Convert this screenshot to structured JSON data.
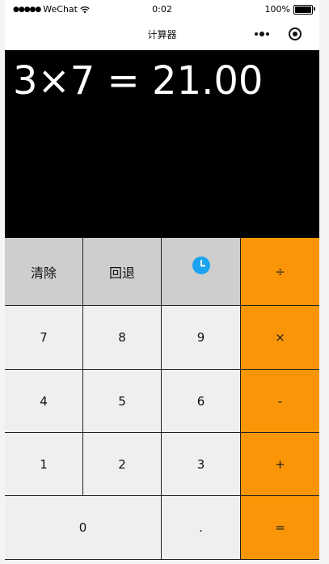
{
  "status_bar": {
    "signal": "●●●●●",
    "carrier": "WeChat",
    "time": "0:02",
    "battery_percent": "100%",
    "battery_level": 1.0,
    "icons": [
      "signal-dots-icon",
      "wifi-icon",
      "battery-icon"
    ]
  },
  "nav": {
    "title": "计算器",
    "more_icon": "more-dots-icon",
    "close_icon": "target-circle-icon"
  },
  "display": {
    "expression": "3×7 = 21.00"
  },
  "keypad": {
    "clear": "清除",
    "backspace": "回退",
    "history_icon": "clock-icon",
    "divide": "÷",
    "multiply": "×",
    "minus": "-",
    "plus": "+",
    "equals": "=",
    "dot": ".",
    "digits": {
      "d0": "0",
      "d1": "1",
      "d2": "2",
      "d3": "3",
      "d4": "4",
      "d5": "5",
      "d6": "6",
      "d7": "7",
      "d8": "8",
      "d9": "9"
    }
  },
  "colors": {
    "operator_bg": "#fb9508",
    "function_bg": "#cecece",
    "digit_bg": "#efefef",
    "display_bg": "#000000",
    "history_icon": "#1aa3f0"
  }
}
